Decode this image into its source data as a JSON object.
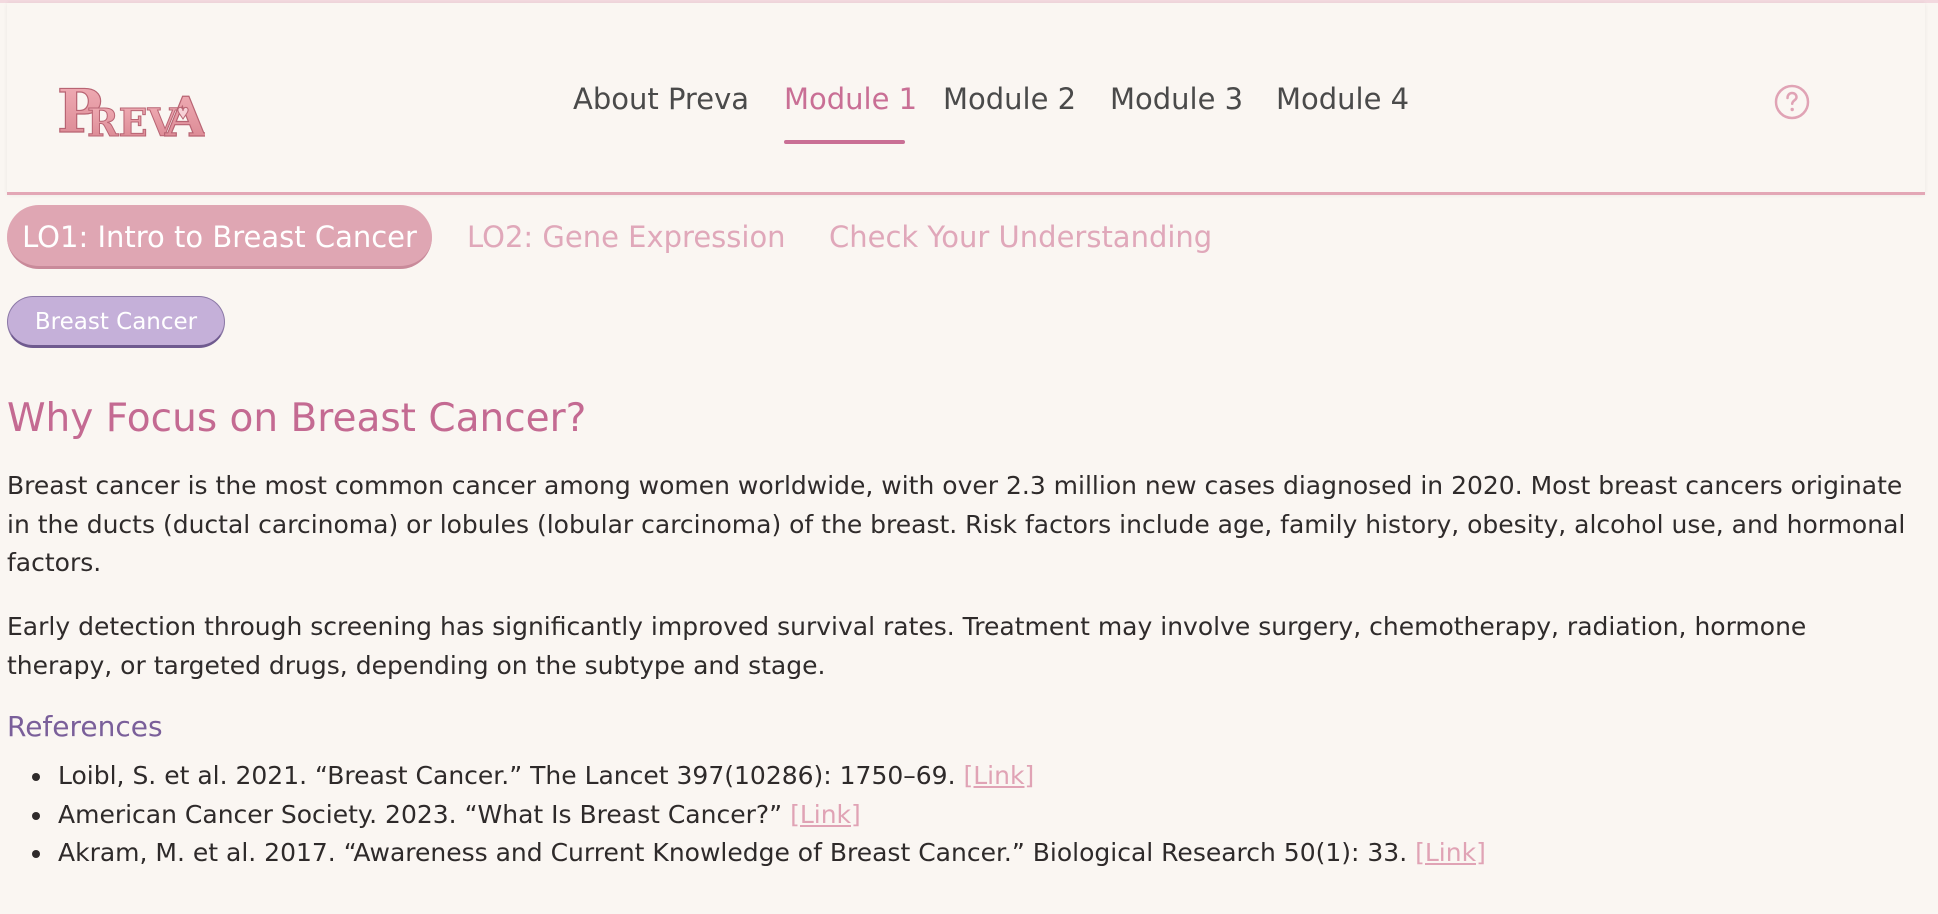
{
  "app": {
    "logo_text": "PREVA"
  },
  "nav": {
    "items": [
      "About Preva",
      "Module 1",
      "Module 2",
      "Module 3",
      "Module 4"
    ],
    "active_index": 1,
    "help_icon": "question-circle-icon"
  },
  "lo_tabs": [
    "LO1: Intro to Breast Cancer",
    "LO2: Gene Expression",
    "Check Your Understanding"
  ],
  "badge": "Breast Cancer",
  "content": {
    "title": "Why Focus on Breast Cancer?",
    "paragraph1": "Breast cancer is the most common cancer among women worldwide, with over 2.3 million new cases diagnosed in 2020. Most breast cancers originate in the ducts (ductal carcinoma) or lobules (lobular carcinoma) of the breast. Risk factors include age, family history, obesity, alcohol use, and hormonal factors.",
    "paragraph2": "Early detection through screening has significantly improved survival rates. Treatment may involve surgery, chemotherapy, radiation, hormone therapy, or targeted drugs, depending on the subtype and stage."
  },
  "references": {
    "title": "References",
    "items": [
      {
        "text": "Loibl, S. et al. 2021. “Breast Cancer.” The Lancet 397(10286): 1750–69.",
        "link": "[Link]"
      },
      {
        "text": "American Cancer Society. 2023. “What Is Breast Cancer?”",
        "link": "[Link]"
      },
      {
        "text": "Akram, M. et al. 2017. “Awareness and Current Knowledge of Breast Cancer.” Biological Research 50(1): 33.",
        "link": "[Link]"
      }
    ]
  },
  "colors": {
    "accent": "#c96f95",
    "tab_active_bg": "#dfa6b3",
    "tab_inactive": "#e0a8ba",
    "badge_bg": "#c5b0d9",
    "refs_title": "#7a5f9a",
    "link": "#e0a3b5",
    "background": "#faf6f2"
  }
}
